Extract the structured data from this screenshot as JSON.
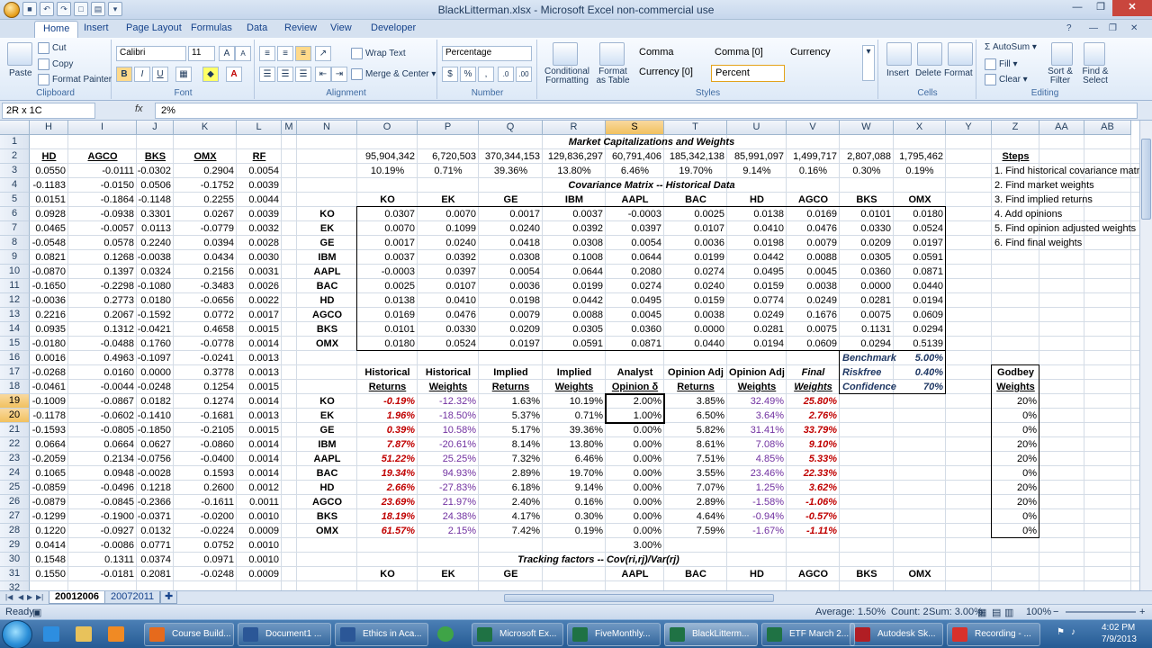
{
  "window": {
    "title": "BlackLitterman.xlsx - Microsoft Excel non-commercial use"
  },
  "tabs": [
    "Home",
    "Insert",
    "Page Layout",
    "Formulas",
    "Data",
    "Review",
    "View",
    "Developer"
  ],
  "ribbon": {
    "clipboard": {
      "paste": "Paste",
      "cut": "Cut",
      "copy": "Copy",
      "format_painter": "Format Painter",
      "label": "Clipboard"
    },
    "font": {
      "name": "Calibri",
      "size": "11",
      "bold": "B",
      "italic": "I",
      "underline": "U",
      "label": "Font"
    },
    "alignment": {
      "wrap": "Wrap Text",
      "merge": "Merge & Center",
      "label": "Alignment"
    },
    "number": {
      "format": "Percentage",
      "currency": "$",
      "percent": "%",
      "comma": ",",
      "label": "Number"
    },
    "styles": {
      "cond": "Conditional Formatting",
      "table": "Format as Table",
      "comma": "Comma",
      "comma0": "Comma [0]",
      "currency": "Currency",
      "currency0": "Currency [0]",
      "percent": "Percent",
      "label": "Styles"
    },
    "cells": {
      "insert": "Insert",
      "delete": "Delete",
      "format": "Format",
      "label": "Cells"
    },
    "editing": {
      "autosum": "AutoSum",
      "fill": "Fill",
      "clear": "Clear",
      "sort": "Sort & Filter",
      "find": "Find & Select",
      "label": "Editing"
    }
  },
  "formula_bar": {
    "name_box": "2R x 1C",
    "fx": "fx",
    "formula": "2%"
  },
  "columns": [
    "H",
    "I",
    "J",
    "K",
    "L",
    "M",
    "N",
    "O",
    "P",
    "Q",
    "R",
    "S",
    "T",
    "U",
    "V",
    "W",
    "X",
    "Y",
    "Z",
    "AA",
    "AB"
  ],
  "rows": [
    "1",
    "2",
    "3",
    "4",
    "5",
    "6",
    "7",
    "8",
    "9",
    "10",
    "11",
    "12",
    "13",
    "14",
    "15",
    "16",
    "17",
    "18",
    "19",
    "20",
    "21",
    "22",
    "23",
    "24",
    "25",
    "26",
    "27",
    "28",
    "29",
    "30",
    "31",
    "32"
  ],
  "left_block": {
    "headers": [
      "HD",
      "AGCO",
      "BKS",
      "OMX",
      "RF"
    ],
    "rows": [
      [
        "0.0550",
        "-0.0111",
        "-0.0302",
        "0.2904",
        "0.0054"
      ],
      [
        "-0.1183",
        "-0.0150",
        "0.0506",
        "-0.1752",
        "0.0039"
      ],
      [
        "0.0151",
        "-0.1864",
        "-0.1148",
        "0.2255",
        "0.0044"
      ],
      [
        "0.0928",
        "-0.0938",
        "0.3301",
        "0.0267",
        "0.0039"
      ],
      [
        "0.0465",
        "-0.0057",
        "0.0113",
        "-0.0779",
        "0.0032"
      ],
      [
        "-0.0548",
        "0.0578",
        "0.2240",
        "0.0394",
        "0.0028"
      ],
      [
        "0.0821",
        "0.1268",
        "-0.0038",
        "0.0434",
        "0.0030"
      ],
      [
        "-0.0870",
        "0.1397",
        "0.0324",
        "0.2156",
        "0.0031"
      ],
      [
        "-0.1650",
        "-0.2298",
        "-0.1080",
        "-0.3483",
        "0.0026"
      ],
      [
        "-0.0036",
        "0.2773",
        "0.0180",
        "-0.0656",
        "0.0022"
      ],
      [
        "0.2216",
        "0.2067",
        "-0.1592",
        "0.0772",
        "0.0017"
      ],
      [
        "0.0935",
        "0.1312",
        "-0.0421",
        "0.4658",
        "0.0015"
      ],
      [
        "-0.0180",
        "-0.0488",
        "0.1760",
        "-0.0778",
        "0.0014"
      ],
      [
        "0.0016",
        "0.4963",
        "-0.1097",
        "-0.0241",
        "0.0013"
      ],
      [
        "-0.0268",
        "0.0160",
        "0.0000",
        "0.3778",
        "0.0013"
      ],
      [
        "-0.0461",
        "-0.0044",
        "-0.0248",
        "0.1254",
        "0.0015"
      ],
      [
        "-0.1009",
        "-0.0867",
        "0.0182",
        "0.1274",
        "0.0014"
      ],
      [
        "-0.1178",
        "-0.0602",
        "-0.1410",
        "-0.1681",
        "0.0013"
      ],
      [
        "-0.1593",
        "-0.0805",
        "-0.1850",
        "-0.2105",
        "0.0015"
      ],
      [
        "0.0664",
        "0.0664",
        "0.0627",
        "-0.0860",
        "0.0014"
      ],
      [
        "-0.2059",
        "0.2134",
        "-0.0756",
        "-0.0400",
        "0.0014"
      ],
      [
        "0.1065",
        "0.0948",
        "-0.0028",
        "0.1593",
        "0.0014"
      ],
      [
        "-0.0859",
        "-0.0496",
        "0.1218",
        "0.2600",
        "0.0012"
      ],
      [
        "-0.0879",
        "-0.0845",
        "-0.2366",
        "-0.1611",
        "0.0011"
      ],
      [
        "-0.1299",
        "-0.1900",
        "-0.0371",
        "-0.0200",
        "0.0010"
      ],
      [
        "0.1220",
        "-0.0927",
        "0.0132",
        "-0.0224",
        "0.0009"
      ],
      [
        "0.0414",
        "-0.0086",
        "0.0771",
        "0.0752",
        "0.0010"
      ],
      [
        "0.1548",
        "0.1311",
        "0.0374",
        "0.0971",
        "0.0010"
      ],
      [
        "0.1550",
        "-0.0181",
        "0.2081",
        "-0.0248",
        "0.0009"
      ]
    ]
  },
  "market": {
    "title": "Market Capitalizations and Weights",
    "caps": [
      "95,904,342",
      "6,720,503",
      "370,344,153",
      "129,836,297",
      "60,791,406",
      "185,342,138",
      "85,991,097",
      "1,499,717",
      "2,807,088",
      "1,795,462"
    ],
    "weights": [
      "10.19%",
      "0.71%",
      "39.36%",
      "13.80%",
      "6.46%",
      "19.70%",
      "9.14%",
      "0.16%",
      "0.30%",
      "0.19%"
    ]
  },
  "cov": {
    "title": "Covariance Matrix -- Historical Data",
    "tickers": [
      "KO",
      "EK",
      "GE",
      "IBM",
      "AAPL",
      "BAC",
      "HD",
      "AGCO",
      "BKS",
      "OMX"
    ],
    "rows": [
      [
        "0.0307",
        "0.0070",
        "0.0017",
        "0.0037",
        "-0.0003",
        "0.0025",
        "0.0138",
        "0.0169",
        "0.0101",
        "0.0180"
      ],
      [
        "0.0070",
        "0.1099",
        "0.0240",
        "0.0392",
        "0.0397",
        "0.0107",
        "0.0410",
        "0.0476",
        "0.0330",
        "0.0524"
      ],
      [
        "0.0017",
        "0.0240",
        "0.0418",
        "0.0308",
        "0.0054",
        "0.0036",
        "0.0198",
        "0.0079",
        "0.0209",
        "0.0197"
      ],
      [
        "0.0037",
        "0.0392",
        "0.0308",
        "0.1008",
        "0.0644",
        "0.0199",
        "0.0442",
        "0.0088",
        "0.0305",
        "0.0591"
      ],
      [
        "-0.0003",
        "0.0397",
        "0.0054",
        "0.0644",
        "0.2080",
        "0.0274",
        "0.0495",
        "0.0045",
        "0.0360",
        "0.0871"
      ],
      [
        "0.0025",
        "0.0107",
        "0.0036",
        "0.0199",
        "0.0274",
        "0.0240",
        "0.0159",
        "0.0038",
        "0.0000",
        "0.0440"
      ],
      [
        "0.0138",
        "0.0410",
        "0.0198",
        "0.0442",
        "0.0495",
        "0.0159",
        "0.0774",
        "0.0249",
        "0.0281",
        "0.0194"
      ],
      [
        "0.0169",
        "0.0476",
        "0.0079",
        "0.0088",
        "0.0045",
        "0.0038",
        "0.0249",
        "0.1676",
        "0.0075",
        "0.0609"
      ],
      [
        "0.0101",
        "0.0330",
        "0.0209",
        "0.0305",
        "0.0360",
        "0.0000",
        "0.0281",
        "0.0075",
        "0.1131",
        "0.0294"
      ],
      [
        "0.0180",
        "0.0524",
        "0.0197",
        "0.0591",
        "0.0871",
        "0.0440",
        "0.0194",
        "0.0609",
        "0.0294",
        "0.5139"
      ]
    ]
  },
  "params": [
    {
      "label": "Benchmark",
      "value": "5.00%"
    },
    {
      "label": "Riskfree",
      "value": "0.40%"
    },
    {
      "label": "Confidence",
      "value": "70%"
    }
  ],
  "opinion": {
    "headers1": [
      "Historical",
      "Historical",
      "Implied",
      "Implied",
      "Analyst",
      "Opinion Adj",
      "Opinion Adj",
      "Final"
    ],
    "headers2": [
      "Returns",
      "Weights",
      "Returns",
      "Weights",
      "Opinion δ",
      "Returns",
      "Weights",
      "Weights"
    ],
    "rows": [
      [
        "KO",
        "-0.19%",
        "-12.32%",
        "1.63%",
        "10.19%",
        "2.00%",
        "3.85%",
        "32.49%",
        "25.80%"
      ],
      [
        "EK",
        "1.96%",
        "-18.50%",
        "5.37%",
        "0.71%",
        "1.00%",
        "6.50%",
        "3.64%",
        "2.76%"
      ],
      [
        "GE",
        "0.39%",
        "10.58%",
        "5.17%",
        "39.36%",
        "0.00%",
        "5.82%",
        "31.41%",
        "33.79%"
      ],
      [
        "IBM",
        "7.87%",
        "-20.61%",
        "8.14%",
        "13.80%",
        "0.00%",
        "8.61%",
        "7.08%",
        "9.10%"
      ],
      [
        "AAPL",
        "51.22%",
        "25.25%",
        "7.32%",
        "6.46%",
        "0.00%",
        "7.51%",
        "4.85%",
        "5.33%"
      ],
      [
        "BAC",
        "19.34%",
        "94.93%",
        "2.89%",
        "19.70%",
        "0.00%",
        "3.55%",
        "23.46%",
        "22.33%"
      ],
      [
        "HD",
        "2.66%",
        "-27.83%",
        "6.18%",
        "9.14%",
        "0.00%",
        "7.07%",
        "1.25%",
        "3.62%"
      ],
      [
        "AGCO",
        "23.69%",
        "21.97%",
        "2.40%",
        "0.16%",
        "0.00%",
        "2.89%",
        "-1.58%",
        "-1.06%"
      ],
      [
        "BKS",
        "18.19%",
        "24.38%",
        "4.17%",
        "0.30%",
        "0.00%",
        "4.64%",
        "-0.94%",
        "-0.57%"
      ],
      [
        "OMX",
        "61.57%",
        "2.15%",
        "7.42%",
        "0.19%",
        "0.00%",
        "7.59%",
        "-1.67%",
        "-1.11%"
      ]
    ],
    "sum": "3.00%"
  },
  "tracking": {
    "title": "Tracking factors -- Cov(ri,rj)/Var(rj)",
    "tickers": [
      "KO",
      "EK",
      "GE",
      "AAPL",
      "BAC",
      "HD",
      "AGCO",
      "BKS",
      "OMX"
    ]
  },
  "steps": {
    "title": "Steps",
    "items": [
      "1. Find historical covariance matr",
      "2. Find market weights",
      "3. Find implied returns",
      "4. Add opinions",
      "5. Find opinion adjusted weights",
      "6. Find final  weights"
    ]
  },
  "godbey": {
    "h1": "Godbey",
    "h2": "Weights",
    "values": [
      "20%",
      "0%",
      "0%",
      "20%",
      "20%",
      "0%",
      "20%",
      "20%",
      "0%",
      "0%"
    ]
  },
  "sheets": [
    "20012006",
    "20072011"
  ],
  "status": {
    "ready": "Ready",
    "average": "Average: 1.50%",
    "count": "Count: 2",
    "sum": "Sum: 3.00%",
    "zoom": "100%"
  },
  "taskbar": {
    "items": [
      "Course Build...",
      "Document1 ...",
      "Ethics in Aca...",
      "Microsoft Ex...",
      "FiveMonthly...",
      "BlackLitterm...",
      "ETF March 2...",
      "Autodesk Sk...",
      "Recording - ..."
    ],
    "time": "4:02 PM",
    "date": "7/9/2013"
  },
  "colors": {
    "accent": "#2b579a",
    "red_text": "#c00000",
    "purple_text": "#7030a0",
    "selected_header": "#f1c15f"
  }
}
